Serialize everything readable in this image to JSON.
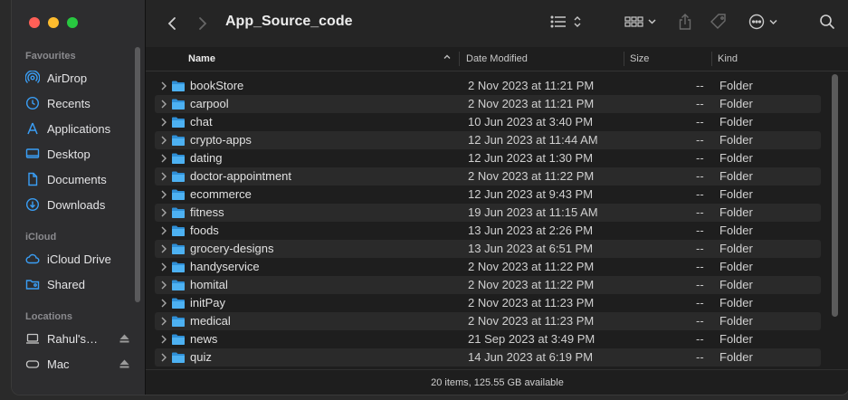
{
  "window": {
    "title": "App_Source_code"
  },
  "sidebar": {
    "sections": [
      {
        "label": "Favourites"
      },
      {
        "label": "iCloud"
      },
      {
        "label": "Locations"
      }
    ],
    "favourites": [
      {
        "label": "AirDrop",
        "icon": "airdrop-icon"
      },
      {
        "label": "Recents",
        "icon": "clock-icon"
      },
      {
        "label": "Applications",
        "icon": "applications-icon"
      },
      {
        "label": "Desktop",
        "icon": "desktop-icon"
      },
      {
        "label": "Documents",
        "icon": "document-icon"
      },
      {
        "label": "Downloads",
        "icon": "download-icon"
      }
    ],
    "icloud": [
      {
        "label": "iCloud Drive",
        "icon": "cloud-icon"
      },
      {
        "label": "Shared",
        "icon": "shared-folder-icon"
      }
    ],
    "locations": [
      {
        "label": "Rahul's…",
        "icon": "laptop-icon"
      },
      {
        "label": "Mac",
        "icon": "disk-icon"
      }
    ]
  },
  "columns": {
    "name": "Name",
    "date": "Date Modified",
    "size": "Size",
    "kind": "Kind"
  },
  "files": [
    {
      "name": "bookStore",
      "date": "2 Nov 2023 at 11:21 PM",
      "size": "--",
      "kind": "Folder"
    },
    {
      "name": "carpool",
      "date": "2 Nov 2023 at 11:21 PM",
      "size": "--",
      "kind": "Folder"
    },
    {
      "name": "chat",
      "date": "10 Jun 2023 at 3:40 PM",
      "size": "--",
      "kind": "Folder"
    },
    {
      "name": "crypto-apps",
      "date": "12 Jun 2023 at 11:44 AM",
      "size": "--",
      "kind": "Folder"
    },
    {
      "name": "dating",
      "date": "12 Jun 2023 at 1:30 PM",
      "size": "--",
      "kind": "Folder"
    },
    {
      "name": "doctor-appointment",
      "date": "2 Nov 2023 at 11:22 PM",
      "size": "--",
      "kind": "Folder"
    },
    {
      "name": "ecommerce",
      "date": "12 Jun 2023 at 9:43 PM",
      "size": "--",
      "kind": "Folder"
    },
    {
      "name": "fitness",
      "date": "19 Jun 2023 at 11:15 AM",
      "size": "--",
      "kind": "Folder"
    },
    {
      "name": "foods",
      "date": "13 Jun 2023 at 2:26 PM",
      "size": "--",
      "kind": "Folder"
    },
    {
      "name": "grocery-designs",
      "date": "13 Jun 2023 at 6:51 PM",
      "size": "--",
      "kind": "Folder"
    },
    {
      "name": "handyservice",
      "date": "2 Nov 2023 at 11:22 PM",
      "size": "--",
      "kind": "Folder"
    },
    {
      "name": "homital",
      "date": "2 Nov 2023 at 11:22 PM",
      "size": "--",
      "kind": "Folder"
    },
    {
      "name": "initPay",
      "date": "2 Nov 2023 at 11:23 PM",
      "size": "--",
      "kind": "Folder"
    },
    {
      "name": "medical",
      "date": "2 Nov 2023 at 11:23 PM",
      "size": "--",
      "kind": "Folder"
    },
    {
      "name": "news",
      "date": "21 Sep 2023 at 3:49 PM",
      "size": "--",
      "kind": "Folder"
    },
    {
      "name": "quiz",
      "date": "14 Jun 2023 at 6:19 PM",
      "size": "--",
      "kind": "Folder"
    }
  ],
  "status": {
    "text": "20 items, 125.55 GB available"
  },
  "colors": {
    "accent": "#3a9ef5",
    "folder": "#4db1f2"
  }
}
